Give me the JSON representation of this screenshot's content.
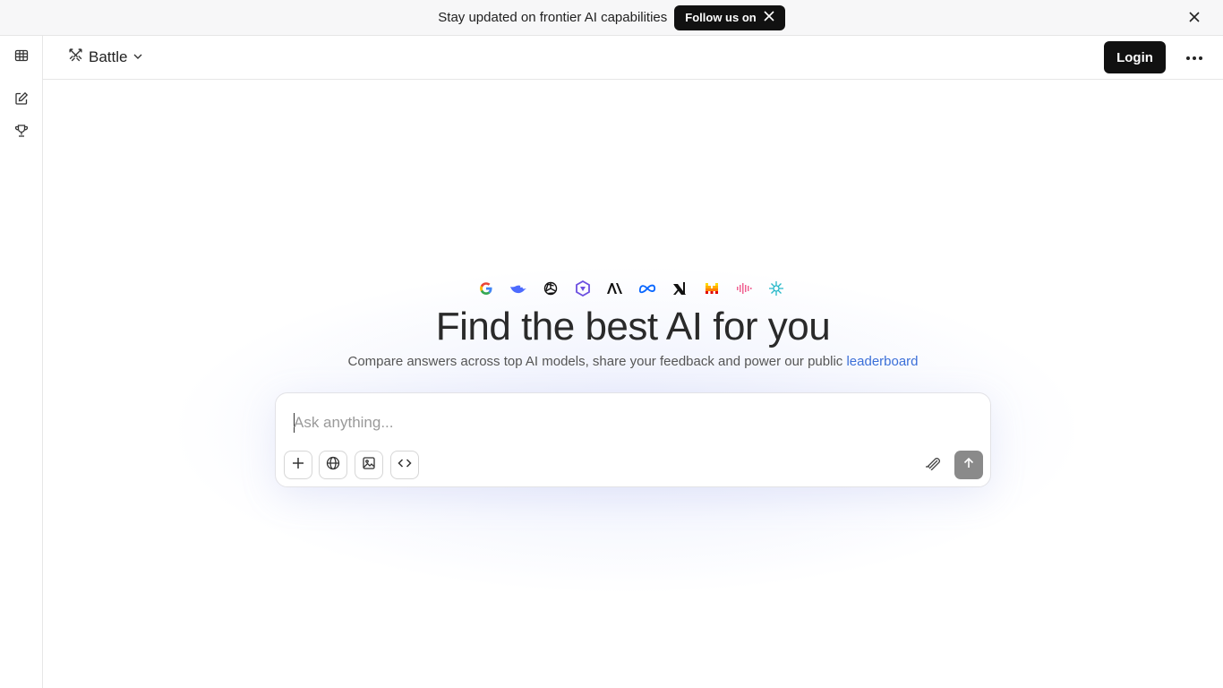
{
  "banner": {
    "text": "Stay updated on frontier AI capabilities",
    "follow_label": "Follow us on",
    "follow_icon": "x-logo-icon",
    "close_icon": "close-icon"
  },
  "rail": {
    "items": [
      {
        "name": "leaderboard-table",
        "icon": "table-icon"
      },
      {
        "name": "new-chat",
        "icon": "edit-icon"
      },
      {
        "name": "leaderboard",
        "icon": "trophy-icon"
      }
    ]
  },
  "header": {
    "mode_label": "Battle",
    "login_label": "Login",
    "more_icon": "more-horizontal-icon"
  },
  "hero": {
    "title": "Find the best AI for you",
    "subtitle": "Compare answers across top AI models, share your feedback and power our public ",
    "link": "leaderboard",
    "providers": [
      "google",
      "deepseek",
      "openai",
      "qwen",
      "anthropic",
      "meta",
      "xai",
      "mistral",
      "stepfun",
      "other"
    ]
  },
  "composer": {
    "placeholder": "Ask anything...",
    "value": "",
    "tools": [
      "add-icon",
      "globe-icon",
      "image-icon",
      "code-icon"
    ],
    "accessory_icon": "cloud-icon",
    "send_icon": "arrow-up-icon"
  },
  "colors": {
    "accent_dark": "#111111",
    "link": "#3b6fd8",
    "send_disabled": "#8a8a8a"
  }
}
